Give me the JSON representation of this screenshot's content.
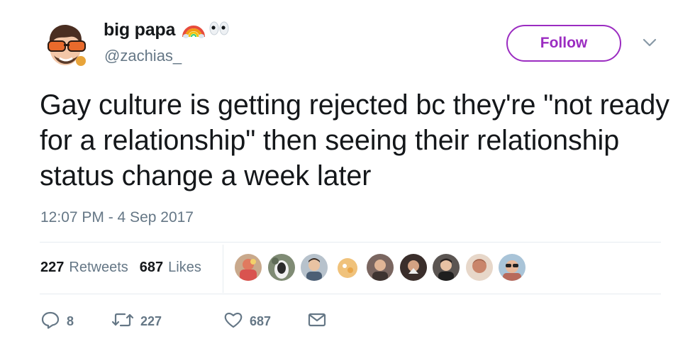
{
  "user": {
    "display_name": "big papa",
    "handle": "@zachias_",
    "name_emoji": [
      "rainbow-emoji",
      "eyes-emoji"
    ]
  },
  "header": {
    "follow_label": "Follow",
    "menu_icon": "chevron-down-icon"
  },
  "tweet": {
    "text": "Gay culture is getting rejected bc they're \"not ready for a relationship\" then seeing their relationship status change a week later",
    "timestamp": "12:07 PM - 4 Sep 2017"
  },
  "stats": {
    "retweets_count": "227",
    "retweets_label": "Retweets",
    "likes_count": "687",
    "likes_label": "Likes"
  },
  "likers": {
    "count_shown": 9,
    "colors": [
      "#d9534f",
      "#6f7a6a",
      "#8a8f95",
      "#e8c48c",
      "#7a6660",
      "#4a3c38",
      "#5b5552",
      "#c9856b",
      "#b86a5c"
    ]
  },
  "actions": {
    "reply_count": "8",
    "retweet_count": "227",
    "like_count": "687",
    "icons": [
      "reply-icon",
      "retweet-icon",
      "heart-icon",
      "envelope-icon"
    ]
  },
  "colors": {
    "accent": "#9b2cc1",
    "secondary_text": "#657786",
    "primary_text": "#14171a",
    "divider": "#e6ecf0"
  }
}
